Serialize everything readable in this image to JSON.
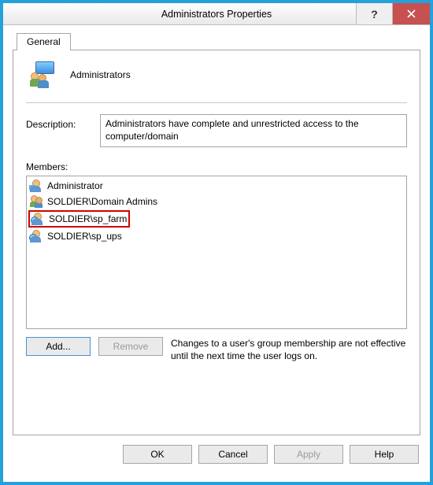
{
  "window": {
    "title": "Administrators Properties"
  },
  "tabs": {
    "general": "General"
  },
  "header": {
    "group_name": "Administrators"
  },
  "description": {
    "label": "Description:",
    "value": "Administrators have complete and unrestricted access to the computer/domain"
  },
  "members": {
    "label": "Members:",
    "items": [
      {
        "name": "Administrator",
        "icon": "user-admin"
      },
      {
        "name": "SOLDIER\\Domain Admins",
        "icon": "group"
      },
      {
        "name": "SOLDIER\\sp_farm",
        "icon": "domain-user",
        "highlighted": true
      },
      {
        "name": "SOLDIER\\sp_ups",
        "icon": "domain-user"
      }
    ]
  },
  "buttons": {
    "add": "Add...",
    "remove": "Remove",
    "ok": "OK",
    "cancel": "Cancel",
    "apply": "Apply",
    "help": "Help"
  },
  "note": "Changes to a user's group membership are not effective until the next time the user logs on."
}
